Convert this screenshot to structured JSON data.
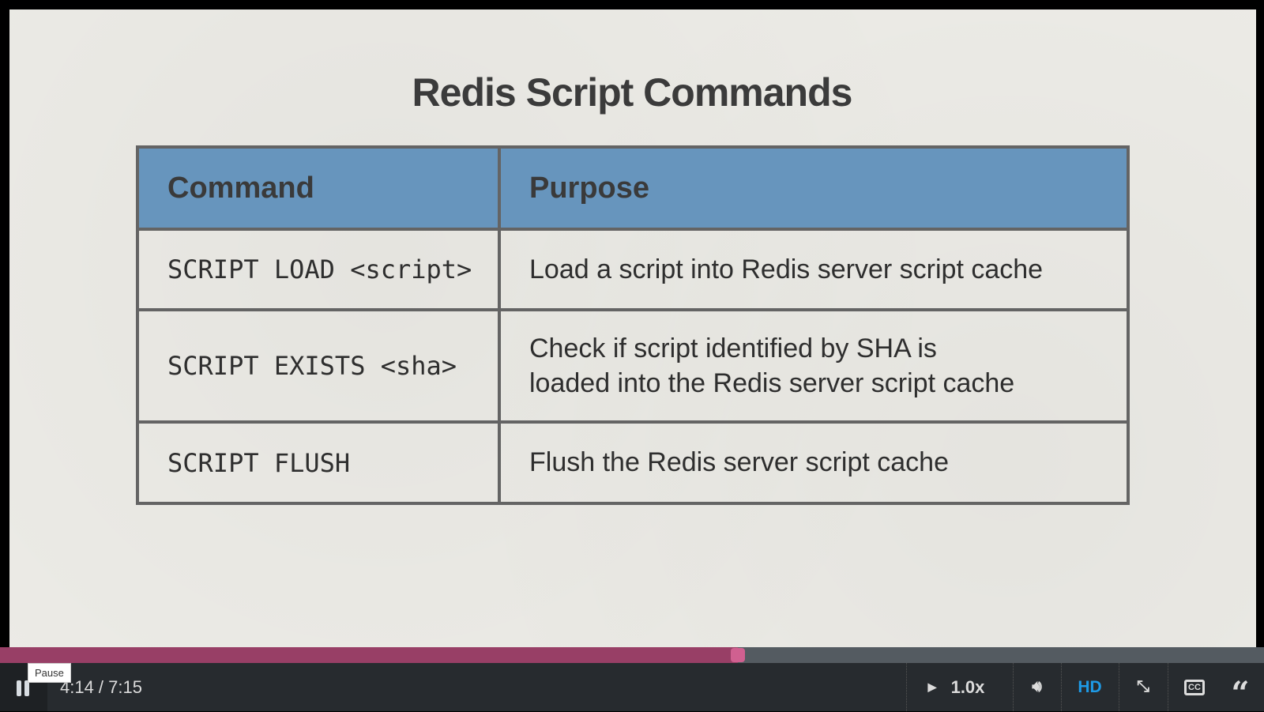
{
  "slide": {
    "title": "Redis Script Commands",
    "table": {
      "headers": [
        "Command",
        "Purpose"
      ],
      "rows": [
        {
          "command": "SCRIPT LOAD <script>",
          "purpose": "Load a script into Redis server script cache"
        },
        {
          "command": "SCRIPT EXISTS <sha>",
          "purpose_line1": "Check if script identified by SHA is",
          "purpose_line2": "loaded into the Redis server script cache"
        },
        {
          "command": "SCRIPT FLUSH",
          "purpose": "Flush the Redis server script cache"
        }
      ]
    }
  },
  "player": {
    "tooltip": "Pause",
    "time": "4:14 / 7:15",
    "progress_fraction": 0.584,
    "speed": "1.0x",
    "quality": "HD",
    "progress_color": "#983f66",
    "hd_color": "#1e9ae6",
    "icons": [
      "pause-icon",
      "speed-arrow-icon",
      "volume-icon",
      "exit-fullscreen-icon",
      "closed-captions-icon",
      "transcript-quote-icon"
    ]
  }
}
